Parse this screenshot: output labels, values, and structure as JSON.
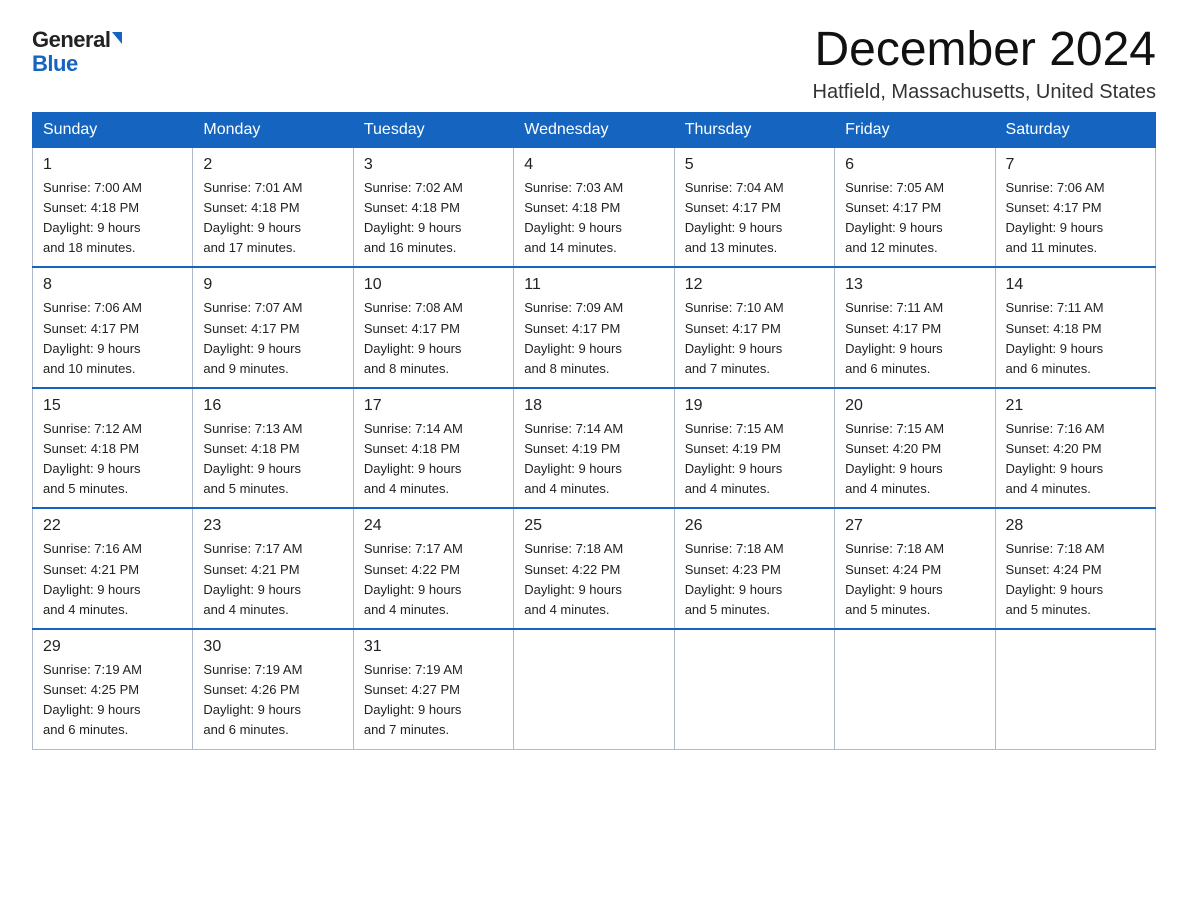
{
  "logo": {
    "general": "General",
    "blue": "Blue"
  },
  "title": "December 2024",
  "subtitle": "Hatfield, Massachusetts, United States",
  "weekdays": [
    "Sunday",
    "Monday",
    "Tuesday",
    "Wednesday",
    "Thursday",
    "Friday",
    "Saturday"
  ],
  "weeks": [
    [
      {
        "day": "1",
        "sunrise": "7:00 AM",
        "sunset": "4:18 PM",
        "daylight": "9 hours and 18 minutes."
      },
      {
        "day": "2",
        "sunrise": "7:01 AM",
        "sunset": "4:18 PM",
        "daylight": "9 hours and 17 minutes."
      },
      {
        "day": "3",
        "sunrise": "7:02 AM",
        "sunset": "4:18 PM",
        "daylight": "9 hours and 16 minutes."
      },
      {
        "day": "4",
        "sunrise": "7:03 AM",
        "sunset": "4:18 PM",
        "daylight": "9 hours and 14 minutes."
      },
      {
        "day": "5",
        "sunrise": "7:04 AM",
        "sunset": "4:17 PM",
        "daylight": "9 hours and 13 minutes."
      },
      {
        "day": "6",
        "sunrise": "7:05 AM",
        "sunset": "4:17 PM",
        "daylight": "9 hours and 12 minutes."
      },
      {
        "day": "7",
        "sunrise": "7:06 AM",
        "sunset": "4:17 PM",
        "daylight": "9 hours and 11 minutes."
      }
    ],
    [
      {
        "day": "8",
        "sunrise": "7:06 AM",
        "sunset": "4:17 PM",
        "daylight": "9 hours and 10 minutes."
      },
      {
        "day": "9",
        "sunrise": "7:07 AM",
        "sunset": "4:17 PM",
        "daylight": "9 hours and 9 minutes."
      },
      {
        "day": "10",
        "sunrise": "7:08 AM",
        "sunset": "4:17 PM",
        "daylight": "9 hours and 8 minutes."
      },
      {
        "day": "11",
        "sunrise": "7:09 AM",
        "sunset": "4:17 PM",
        "daylight": "9 hours and 8 minutes."
      },
      {
        "day": "12",
        "sunrise": "7:10 AM",
        "sunset": "4:17 PM",
        "daylight": "9 hours and 7 minutes."
      },
      {
        "day": "13",
        "sunrise": "7:11 AM",
        "sunset": "4:17 PM",
        "daylight": "9 hours and 6 minutes."
      },
      {
        "day": "14",
        "sunrise": "7:11 AM",
        "sunset": "4:18 PM",
        "daylight": "9 hours and 6 minutes."
      }
    ],
    [
      {
        "day": "15",
        "sunrise": "7:12 AM",
        "sunset": "4:18 PM",
        "daylight": "9 hours and 5 minutes."
      },
      {
        "day": "16",
        "sunrise": "7:13 AM",
        "sunset": "4:18 PM",
        "daylight": "9 hours and 5 minutes."
      },
      {
        "day": "17",
        "sunrise": "7:14 AM",
        "sunset": "4:18 PM",
        "daylight": "9 hours and 4 minutes."
      },
      {
        "day": "18",
        "sunrise": "7:14 AM",
        "sunset": "4:19 PM",
        "daylight": "9 hours and 4 minutes."
      },
      {
        "day": "19",
        "sunrise": "7:15 AM",
        "sunset": "4:19 PM",
        "daylight": "9 hours and 4 minutes."
      },
      {
        "day": "20",
        "sunrise": "7:15 AM",
        "sunset": "4:20 PM",
        "daylight": "9 hours and 4 minutes."
      },
      {
        "day": "21",
        "sunrise": "7:16 AM",
        "sunset": "4:20 PM",
        "daylight": "9 hours and 4 minutes."
      }
    ],
    [
      {
        "day": "22",
        "sunrise": "7:16 AM",
        "sunset": "4:21 PM",
        "daylight": "9 hours and 4 minutes."
      },
      {
        "day": "23",
        "sunrise": "7:17 AM",
        "sunset": "4:21 PM",
        "daylight": "9 hours and 4 minutes."
      },
      {
        "day": "24",
        "sunrise": "7:17 AM",
        "sunset": "4:22 PM",
        "daylight": "9 hours and 4 minutes."
      },
      {
        "day": "25",
        "sunrise": "7:18 AM",
        "sunset": "4:22 PM",
        "daylight": "9 hours and 4 minutes."
      },
      {
        "day": "26",
        "sunrise": "7:18 AM",
        "sunset": "4:23 PM",
        "daylight": "9 hours and 5 minutes."
      },
      {
        "day": "27",
        "sunrise": "7:18 AM",
        "sunset": "4:24 PM",
        "daylight": "9 hours and 5 minutes."
      },
      {
        "day": "28",
        "sunrise": "7:18 AM",
        "sunset": "4:24 PM",
        "daylight": "9 hours and 5 minutes."
      }
    ],
    [
      {
        "day": "29",
        "sunrise": "7:19 AM",
        "sunset": "4:25 PM",
        "daylight": "9 hours and 6 minutes."
      },
      {
        "day": "30",
        "sunrise": "7:19 AM",
        "sunset": "4:26 PM",
        "daylight": "9 hours and 6 minutes."
      },
      {
        "day": "31",
        "sunrise": "7:19 AM",
        "sunset": "4:27 PM",
        "daylight": "9 hours and 7 minutes."
      },
      null,
      null,
      null,
      null
    ]
  ]
}
